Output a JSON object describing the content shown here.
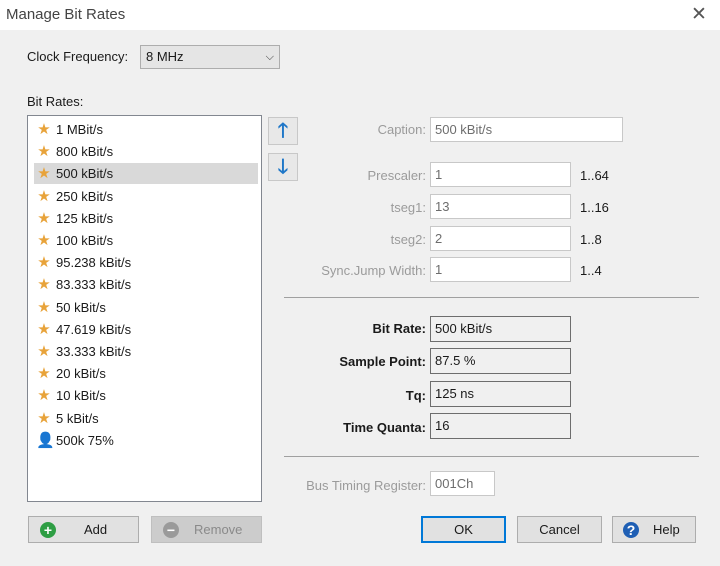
{
  "window": {
    "title": "Manage Bit Rates",
    "close_glyph": "✕"
  },
  "clock": {
    "label": "Clock Frequency:",
    "value": "8 MHz"
  },
  "bit_rates": {
    "label": "Bit Rates:",
    "items": [
      {
        "label": "1 MBit/s",
        "icon": "star-icon"
      },
      {
        "label": "800 kBit/s",
        "icon": "star-icon"
      },
      {
        "label": "500 kBit/s",
        "icon": "star-icon",
        "selected": true
      },
      {
        "label": "250 kBit/s",
        "icon": "star-icon"
      },
      {
        "label": "125 kBit/s",
        "icon": "star-icon"
      },
      {
        "label": "100 kBit/s",
        "icon": "star-icon"
      },
      {
        "label": "95.238 kBit/s",
        "icon": "star-icon"
      },
      {
        "label": "83.333 kBit/s",
        "icon": "star-icon"
      },
      {
        "label": "50 kBit/s",
        "icon": "star-icon"
      },
      {
        "label": "47.619 kBit/s",
        "icon": "star-icon"
      },
      {
        "label": "33.333 kBit/s",
        "icon": "star-icon"
      },
      {
        "label": "20 kBit/s",
        "icon": "star-icon"
      },
      {
        "label": "10 kBit/s",
        "icon": "star-icon"
      },
      {
        "label": "5 kBit/s",
        "icon": "star-icon"
      },
      {
        "label": "500k 75%",
        "icon": "user-icon"
      }
    ]
  },
  "move_buttons": {
    "up_glyph": "🡑",
    "down_glyph": "🡓"
  },
  "settings": {
    "caption": {
      "label": "Caption:",
      "value": "500 kBit/s"
    },
    "prescaler": {
      "label": "Prescaler:",
      "value": "1",
      "range": "1..64"
    },
    "tseg1": {
      "label": "tseg1:",
      "value": "13",
      "range": "1..16"
    },
    "tseg2": {
      "label": "tseg2:",
      "value": "2",
      "range": "1..8"
    },
    "sjw": {
      "label": "Sync.Jump Width:",
      "value": "1",
      "range": "1..4"
    }
  },
  "results": {
    "bit_rate": {
      "label": "Bit Rate:",
      "value": "500 kBit/s"
    },
    "sample_point": {
      "label": "Sample Point:",
      "value": "87.5 %"
    },
    "tq": {
      "label": "Tq:",
      "value": "125 ns"
    },
    "time_quanta": {
      "label": "Time Quanta:",
      "value": "16"
    }
  },
  "btr": {
    "label": "Bus Timing Register:",
    "value": "001Ch"
  },
  "buttons": {
    "add": "Add",
    "remove": "Remove",
    "ok": "OK",
    "cancel": "Cancel",
    "help": "Help"
  },
  "colors": {
    "star": "#e8a33a",
    "user": "#2f6fbf",
    "accent": "#0078d7",
    "add_icon": "#2e9e44",
    "help_icon": "#1f5fb4"
  }
}
